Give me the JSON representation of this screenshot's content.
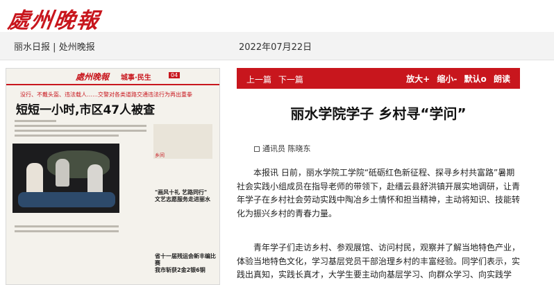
{
  "header": {
    "logo": "處州晚報"
  },
  "topbar": {
    "link1": "丽水日报",
    "separator": "|",
    "link2": "处州晚报",
    "date": "2022年07月22日"
  },
  "thumbnail": {
    "logo": "處州晚報",
    "section": "城事·民生",
    "page": "04",
    "kicker": "没行、不戴头盔、违法载人……交警对各类道路交通违法行为再出重拳",
    "headline": "短短一小时,市区47人被查",
    "side_caption": "乡间",
    "sub1_line1": "\"画风十礼 艺路同行\"",
    "sub1_line2": "文艺志愿服务走进丽水",
    "sub2_line1": "省十一届残运会新丰编比赛",
    "sub2_line2": "我市斩获2金2银6铜"
  },
  "nav": {
    "prev": "上一篇",
    "next": "下一篇",
    "zoom_in": "放大+",
    "zoom_out": "缩小-",
    "default": "默认o",
    "read_aloud": "朗读"
  },
  "article": {
    "title": "丽水学院学子 乡村寻“学问”",
    "byline": "通讯员 陈晓东",
    "p1": "本报讯 日前，丽水学院工学院“砥砺红色新征程、探寻乡村共富路”暑期社会实践小组成员在指导老师的带领下，赴缙云县舒洪镇开展实地调研，让青年学子在乡村社会劳动实践中陶冶乡土情怀和担当精神，主动将知识、技能转化为振兴乡村的青春力量。",
    "p2": "青年学子们走访乡村、参观展馆、访问村民，观察并了解当地特色产业，体验当地特色文化，学习基层党员干部治理乡村的丰富经验。同学们表示，实践出真知，实践长真才，大学生要主动向基层学习、向群众学习、向实践学"
  }
}
